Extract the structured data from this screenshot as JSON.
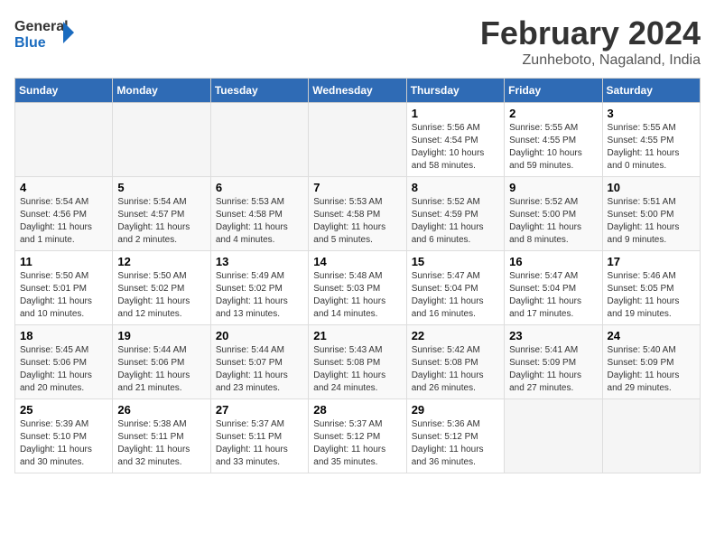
{
  "logo": {
    "line1": "General",
    "line2": "Blue"
  },
  "title": "February 2024",
  "subtitle": "Zunheboto, Nagaland, India",
  "days_of_week": [
    "Sunday",
    "Monday",
    "Tuesday",
    "Wednesday",
    "Thursday",
    "Friday",
    "Saturday"
  ],
  "weeks": [
    [
      {
        "num": "",
        "info": ""
      },
      {
        "num": "",
        "info": ""
      },
      {
        "num": "",
        "info": ""
      },
      {
        "num": "",
        "info": ""
      },
      {
        "num": "1",
        "info": "Sunrise: 5:56 AM\nSunset: 4:54 PM\nDaylight: 10 hours\nand 58 minutes."
      },
      {
        "num": "2",
        "info": "Sunrise: 5:55 AM\nSunset: 4:55 PM\nDaylight: 10 hours\nand 59 minutes."
      },
      {
        "num": "3",
        "info": "Sunrise: 5:55 AM\nSunset: 4:55 PM\nDaylight: 11 hours\nand 0 minutes."
      }
    ],
    [
      {
        "num": "4",
        "info": "Sunrise: 5:54 AM\nSunset: 4:56 PM\nDaylight: 11 hours\nand 1 minute."
      },
      {
        "num": "5",
        "info": "Sunrise: 5:54 AM\nSunset: 4:57 PM\nDaylight: 11 hours\nand 2 minutes."
      },
      {
        "num": "6",
        "info": "Sunrise: 5:53 AM\nSunset: 4:58 PM\nDaylight: 11 hours\nand 4 minutes."
      },
      {
        "num": "7",
        "info": "Sunrise: 5:53 AM\nSunset: 4:58 PM\nDaylight: 11 hours\nand 5 minutes."
      },
      {
        "num": "8",
        "info": "Sunrise: 5:52 AM\nSunset: 4:59 PM\nDaylight: 11 hours\nand 6 minutes."
      },
      {
        "num": "9",
        "info": "Sunrise: 5:52 AM\nSunset: 5:00 PM\nDaylight: 11 hours\nand 8 minutes."
      },
      {
        "num": "10",
        "info": "Sunrise: 5:51 AM\nSunset: 5:00 PM\nDaylight: 11 hours\nand 9 minutes."
      }
    ],
    [
      {
        "num": "11",
        "info": "Sunrise: 5:50 AM\nSunset: 5:01 PM\nDaylight: 11 hours\nand 10 minutes."
      },
      {
        "num": "12",
        "info": "Sunrise: 5:50 AM\nSunset: 5:02 PM\nDaylight: 11 hours\nand 12 minutes."
      },
      {
        "num": "13",
        "info": "Sunrise: 5:49 AM\nSunset: 5:02 PM\nDaylight: 11 hours\nand 13 minutes."
      },
      {
        "num": "14",
        "info": "Sunrise: 5:48 AM\nSunset: 5:03 PM\nDaylight: 11 hours\nand 14 minutes."
      },
      {
        "num": "15",
        "info": "Sunrise: 5:47 AM\nSunset: 5:04 PM\nDaylight: 11 hours\nand 16 minutes."
      },
      {
        "num": "16",
        "info": "Sunrise: 5:47 AM\nSunset: 5:04 PM\nDaylight: 11 hours\nand 17 minutes."
      },
      {
        "num": "17",
        "info": "Sunrise: 5:46 AM\nSunset: 5:05 PM\nDaylight: 11 hours\nand 19 minutes."
      }
    ],
    [
      {
        "num": "18",
        "info": "Sunrise: 5:45 AM\nSunset: 5:06 PM\nDaylight: 11 hours\nand 20 minutes."
      },
      {
        "num": "19",
        "info": "Sunrise: 5:44 AM\nSunset: 5:06 PM\nDaylight: 11 hours\nand 21 minutes."
      },
      {
        "num": "20",
        "info": "Sunrise: 5:44 AM\nSunset: 5:07 PM\nDaylight: 11 hours\nand 23 minutes."
      },
      {
        "num": "21",
        "info": "Sunrise: 5:43 AM\nSunset: 5:08 PM\nDaylight: 11 hours\nand 24 minutes."
      },
      {
        "num": "22",
        "info": "Sunrise: 5:42 AM\nSunset: 5:08 PM\nDaylight: 11 hours\nand 26 minutes."
      },
      {
        "num": "23",
        "info": "Sunrise: 5:41 AM\nSunset: 5:09 PM\nDaylight: 11 hours\nand 27 minutes."
      },
      {
        "num": "24",
        "info": "Sunrise: 5:40 AM\nSunset: 5:09 PM\nDaylight: 11 hours\nand 29 minutes."
      }
    ],
    [
      {
        "num": "25",
        "info": "Sunrise: 5:39 AM\nSunset: 5:10 PM\nDaylight: 11 hours\nand 30 minutes."
      },
      {
        "num": "26",
        "info": "Sunrise: 5:38 AM\nSunset: 5:11 PM\nDaylight: 11 hours\nand 32 minutes."
      },
      {
        "num": "27",
        "info": "Sunrise: 5:37 AM\nSunset: 5:11 PM\nDaylight: 11 hours\nand 33 minutes."
      },
      {
        "num": "28",
        "info": "Sunrise: 5:37 AM\nSunset: 5:12 PM\nDaylight: 11 hours\nand 35 minutes."
      },
      {
        "num": "29",
        "info": "Sunrise: 5:36 AM\nSunset: 5:12 PM\nDaylight: 11 hours\nand 36 minutes."
      },
      {
        "num": "",
        "info": ""
      },
      {
        "num": "",
        "info": ""
      }
    ]
  ]
}
